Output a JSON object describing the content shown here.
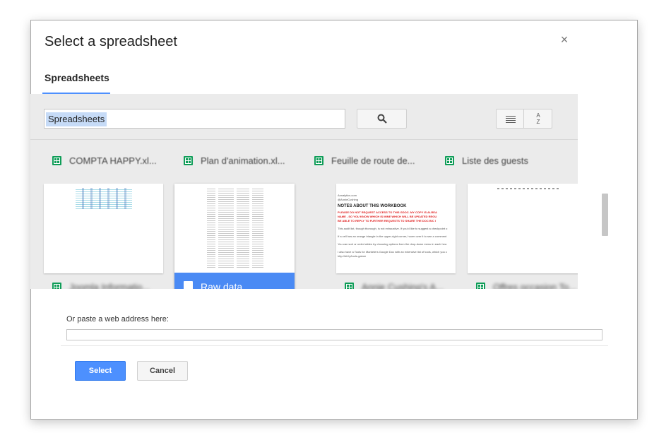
{
  "dialog": {
    "title": "Select a spreadsheet",
    "close_symbol": "×"
  },
  "tabs": [
    {
      "label": "Spreadsheets",
      "active": true
    }
  ],
  "search": {
    "value": "Spreadsheets"
  },
  "partial_row": [
    {
      "name": "COMPTA HAPPY.xl..."
    },
    {
      "name": "Plan d'animation.xl..."
    },
    {
      "name": "Feuille de route de..."
    },
    {
      "name": "Liste des guests"
    }
  ],
  "files": [
    {
      "name": "Joomla Informatio...",
      "selected": false
    },
    {
      "name": "Raw data",
      "selected": true
    },
    {
      "name": "Annie Cushing's A...",
      "selected": false
    },
    {
      "name": "Offres occasion To...",
      "selected": false
    }
  ],
  "thumb3": {
    "lines": [
      "Annalytics.com",
      "@AnnieCushing"
    ],
    "heading": "NOTES ABOUT THIS WORKBOOK",
    "warning": [
      "PLEASE DO NOT REQUEST ACCESS TO THIS GDOC. MY COPY IS ALREA",
      "NAME - SO YOU KNOW WHICH IS MINE WHICH WILL BE UPDATED REGU",
      "BE ABLE TO REPLY TO FURTHER REQUESTS TO SHARE THE DOC B/C I"
    ],
    "body": [
      "This audit list, though thorough, is not exhaustive. If you'd like to suggest a checkpoint o",
      "If a cell has an orange triangle in the upper-right corner, hover over it to see a comment",
      "You can sort or order tables  by choosing options from the drop-down menu in each hea",
      "I also have a Tools for Marketers Google Doc with an extensive list of tools, which you c",
      "http://bit.ly/tools-galore"
    ]
  },
  "paste": {
    "label": "Or paste a web address here:",
    "value": ""
  },
  "buttons": {
    "select": "Select",
    "cancel": "Cancel"
  },
  "colors": {
    "accent": "#4d90fe",
    "selected_card": "#4a8af4",
    "sheets_green": "#0f9d58"
  }
}
